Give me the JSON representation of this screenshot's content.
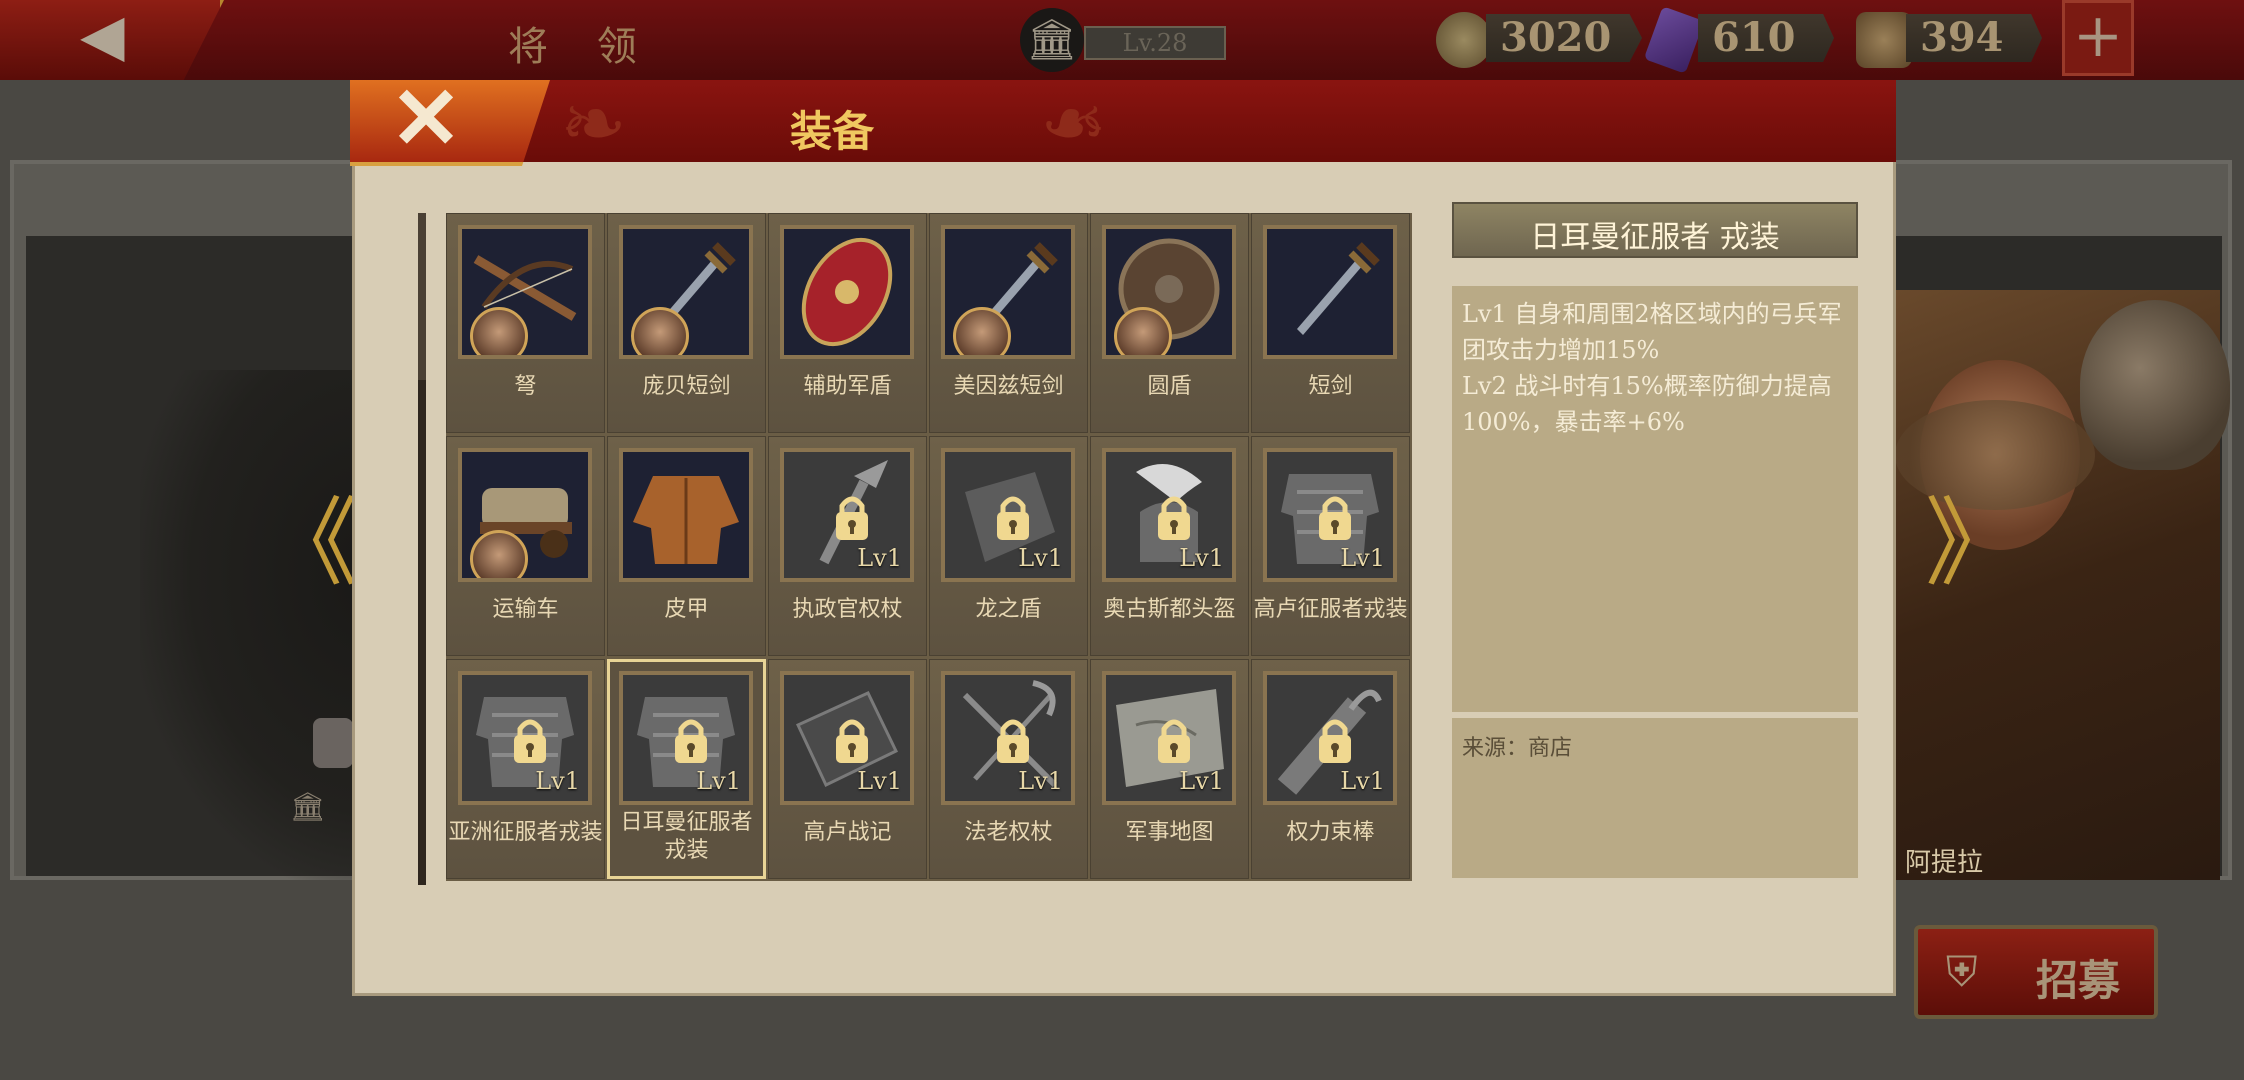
{
  "topbar": {
    "title": "将 领",
    "level": "Lv.28",
    "coins": "3020",
    "gems": "610",
    "tickets": "394",
    "plus": "+"
  },
  "background": {
    "hero_name": "阿提拉",
    "recruit_label": "招募"
  },
  "modal": {
    "title": "装备",
    "items": [
      {
        "name": "弩",
        "type": "crossbow",
        "hero": true,
        "locked": false
      },
      {
        "name": "庞贝短剑",
        "type": "sword",
        "hero": true,
        "locked": false
      },
      {
        "name": "辅助军盾",
        "type": "shield-oval",
        "hero": false,
        "locked": false
      },
      {
        "name": "美因兹短剑",
        "type": "sword",
        "hero": true,
        "locked": false
      },
      {
        "name": "圆盾",
        "type": "shield-round",
        "hero": true,
        "locked": false
      },
      {
        "name": "短剑",
        "type": "sword",
        "hero": false,
        "locked": false
      },
      {
        "name": "运输车",
        "type": "cart",
        "hero": true,
        "locked": false
      },
      {
        "name": "皮甲",
        "type": "leather",
        "hero": false,
        "locked": false
      },
      {
        "name": "执政官权杖",
        "type": "scepter",
        "hero": false,
        "locked": true,
        "level": "Lv1"
      },
      {
        "name": "龙之盾",
        "type": "shield-dark",
        "hero": false,
        "locked": true,
        "level": "Lv1"
      },
      {
        "name": "奥古斯都头盔",
        "type": "helmet",
        "hero": false,
        "locked": true,
        "level": "Lv1"
      },
      {
        "name": "高卢征服者戎装",
        "type": "armor",
        "hero": false,
        "locked": true,
        "level": "Lv1"
      },
      {
        "name": "亚洲征服者戎装",
        "type": "armor",
        "hero": false,
        "locked": true,
        "level": "Lv1"
      },
      {
        "name": "日耳曼征服者\n戎装",
        "type": "armor",
        "hero": false,
        "locked": true,
        "level": "Lv1",
        "selected": true
      },
      {
        "name": "高卢战记",
        "type": "book",
        "hero": false,
        "locked": true,
        "level": "Lv1"
      },
      {
        "name": "法老权杖",
        "type": "flail",
        "hero": false,
        "locked": true,
        "level": "Lv1"
      },
      {
        "name": "军事地图",
        "type": "map",
        "hero": false,
        "locked": true,
        "level": "Lv1"
      },
      {
        "name": "权力束棒",
        "type": "fasces",
        "hero": false,
        "locked": true,
        "level": "Lv1"
      }
    ],
    "detail": {
      "title": "日耳曼征服者 戎装",
      "lv1": "Lv1  自身和周围2格区域内的弓兵军团攻击力增加15%",
      "lv2": "Lv2  战斗时有15%概率防御力提高100%，暴击率+6%",
      "source": "来源：商店"
    }
  },
  "colors": {
    "header_red": "#7a1010",
    "gold": "#f0c860",
    "panel": "#d8cdb5",
    "grid": "#6a5d45"
  }
}
